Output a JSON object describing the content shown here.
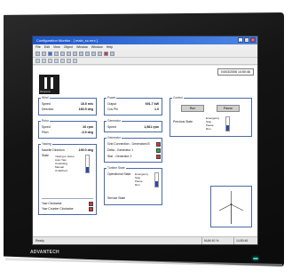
{
  "device": {
    "brand": "ADVANTECH"
  },
  "window": {
    "title": "Configuration Monitor - [ main_sc.mrc ]",
    "buttons": [
      "_",
      "□",
      "×"
    ]
  },
  "menu": [
    "File",
    "Edit",
    "View",
    "Object",
    "Window",
    "Window",
    "Help"
  ],
  "hmi": {
    "datetime": "04/03/2006 14:50:46",
    "logo_sub": "Windpower",
    "wind": {
      "title": "Wind",
      "rows": [
        {
          "label": "Speed",
          "value": "18.5 m/s"
        },
        {
          "label": "Direction",
          "value": "180.5 deg"
        }
      ]
    },
    "rotor": {
      "title": "Rotor",
      "rows": [
        {
          "label": "Speed",
          "value": "26 rpm"
        },
        {
          "label": "Pitch",
          "value": "-0.5 deg"
        }
      ]
    },
    "yawing": {
      "title": "Yawing",
      "nacelle_label": "Nacelle Direction",
      "nacelle_value": "190.0 deg",
      "state_label": "State",
      "states": [
        "Yawing to Home",
        "Auto Yaw",
        "Unwinding",
        "Manual",
        "Undefined"
      ],
      "yaw_cw": "Yaw Clockwise",
      "yaw_ccw": "Yaw Counter Clockwise"
    },
    "power": {
      "title": "Power",
      "rows": [
        {
          "label": "Output",
          "value": "691.7 kW"
        },
        {
          "label": "Cos Phi",
          "value": "1.0"
        }
      ]
    },
    "generator_speed": {
      "title": "Generator",
      "rows": [
        {
          "label": "Speed",
          "value": "1,581 rpm"
        }
      ]
    },
    "generator": {
      "title": "Generator",
      "items": [
        {
          "label": "Grid Connection - Generators B",
          "lamp": "red"
        },
        {
          "label": "Delta - Generator 1",
          "lamp": "green"
        },
        {
          "label": "Star - Generator 2",
          "lamp": "red"
        }
      ]
    },
    "turbine_state": {
      "title": "Turbine State",
      "label": "Operational State",
      "states": [
        "Emergency",
        "Stop",
        "Pause",
        "Run"
      ],
      "service": "Service State"
    },
    "control": {
      "title": "Control",
      "run": "Run",
      "pause": "Pause",
      "prev_label": "Previous State",
      "states": [
        "Emergency",
        "Stop",
        "Pause",
        "Run"
      ]
    }
  },
  "status": {
    "left": "Ready",
    "mid": "NUM 40 %",
    "right": "14:50:46"
  }
}
